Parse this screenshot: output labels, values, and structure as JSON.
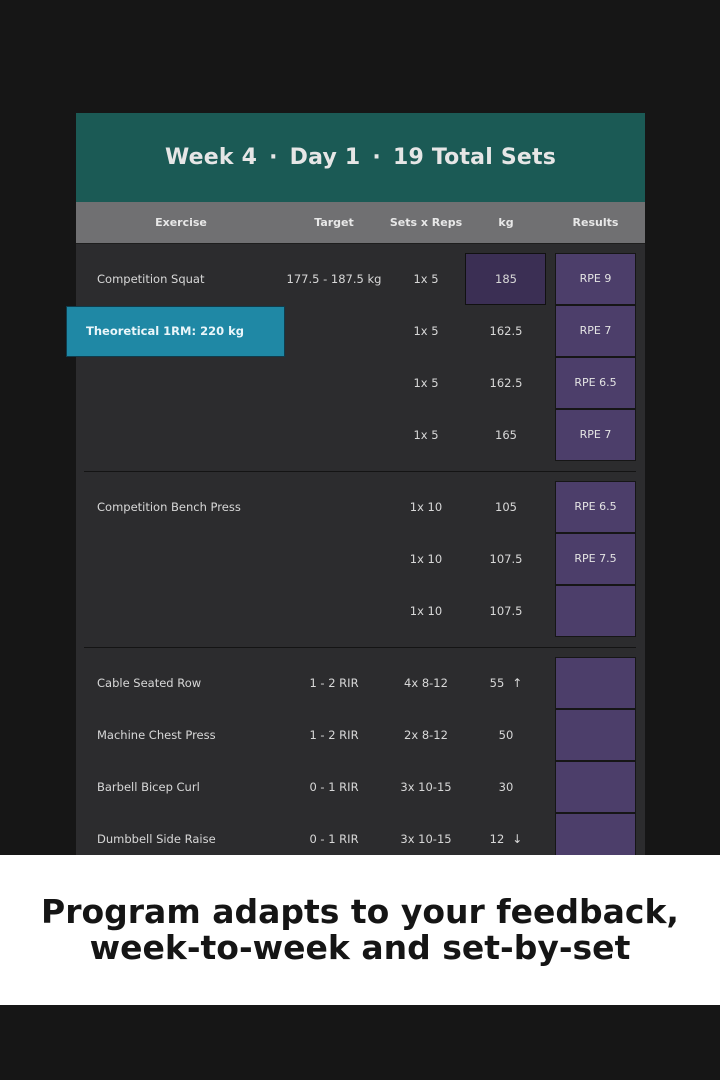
{
  "header": {
    "week": "Week 4",
    "day": "Day 1",
    "total_sets": "19 Total Sets",
    "separator": "·"
  },
  "columns": {
    "exercise": "Exercise",
    "target": "Target",
    "sets_reps": "Sets x Reps",
    "kg": "kg",
    "results": "Results"
  },
  "tooltip": {
    "text": "Theoretical 1RM:  220 kg"
  },
  "rows": [
    {
      "exercise": "Competition Squat",
      "target": "177.5 - 187.5 kg",
      "sets_reps": "1x 5",
      "kg": "185",
      "result": "RPE 9"
    },
    {
      "exercise": "",
      "target": "",
      "sets_reps": "1x 5",
      "kg": "162.5",
      "result": "RPE 7"
    },
    {
      "exercise": "",
      "target": "",
      "sets_reps": "1x 5",
      "kg": "162.5",
      "result": "RPE 6.5"
    },
    {
      "exercise": "",
      "target": "",
      "sets_reps": "1x 5",
      "kg": "165",
      "result": "RPE 7"
    },
    {
      "exercise": "Competition Bench Press",
      "target": "",
      "sets_reps": "1x 10",
      "kg": "105",
      "result": "RPE 6.5"
    },
    {
      "exercise": "",
      "target": "",
      "sets_reps": "1x 10",
      "kg": "107.5",
      "result": "RPE 7.5"
    },
    {
      "exercise": "",
      "target": "",
      "sets_reps": "1x 10",
      "kg": "107.5",
      "result": ""
    },
    {
      "exercise": "Cable Seated Row",
      "target": "1 - 2 RIR",
      "sets_reps": "4x 8-12",
      "kg": "55",
      "kg_arrow": "↑",
      "result": ""
    },
    {
      "exercise": "Machine Chest Press",
      "target": "1 - 2 RIR",
      "sets_reps": "2x 8-12",
      "kg": "50",
      "result": ""
    },
    {
      "exercise": "Barbell Bicep Curl",
      "target": "0 - 1 RIR",
      "sets_reps": "3x 10-15",
      "kg": "30",
      "result": ""
    },
    {
      "exercise": "Dumbbell Side Raise",
      "target": "0 - 1 RIR",
      "sets_reps": "3x 10-15",
      "kg": "12",
      "kg_arrow": "↓",
      "result": ""
    }
  ],
  "caption": {
    "line1": "Program adapts to your feedback,",
    "line2": "week-to-week and set-by-set"
  },
  "colors": {
    "banner": "#1b5a55",
    "header_row": "#707072",
    "result_cell": "#4c3e6a",
    "tooltip": "#1f88a5"
  }
}
